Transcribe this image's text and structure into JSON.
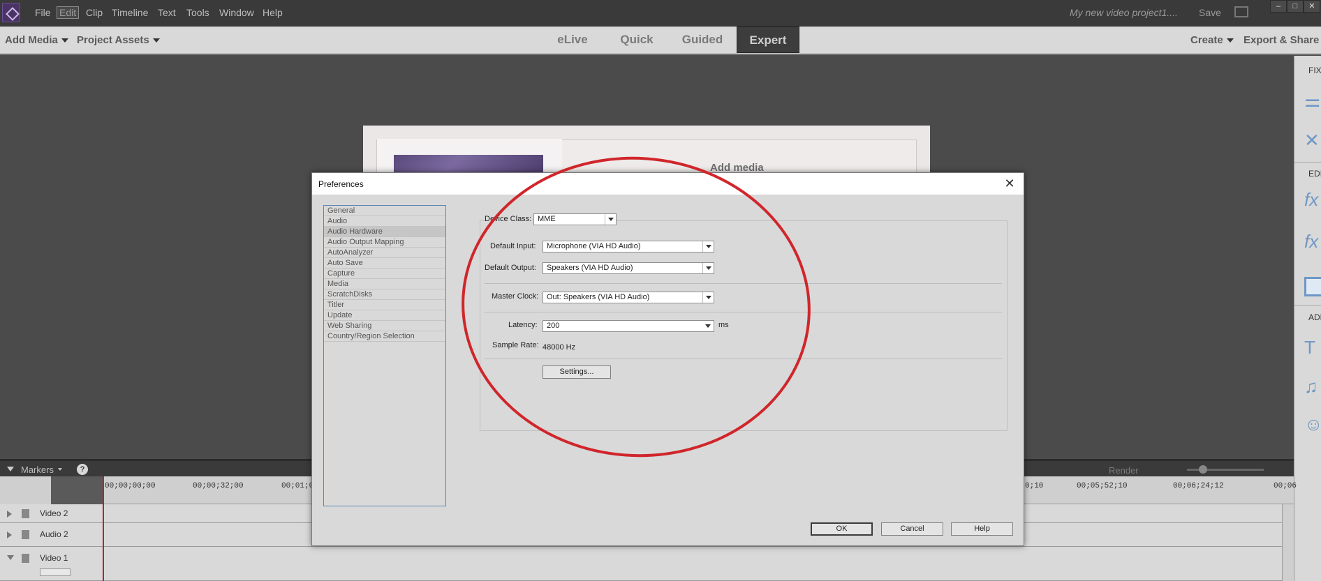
{
  "menubar": {
    "items": [
      "File",
      "Edit",
      "Clip",
      "Timeline",
      "Text",
      "Tools",
      "Window",
      "Help"
    ],
    "project_title": "My new video project1....",
    "save_label": "Save"
  },
  "toolbar": {
    "add_media": "Add Media",
    "project_assets": "Project Assets",
    "modes": [
      "eLive",
      "Quick",
      "Guided",
      "Expert"
    ],
    "active_mode": "Expert",
    "create": "Create",
    "export_share": "Export & Share"
  },
  "right_panel": {
    "fix_label": "FIX",
    "edit_label": "EDIT",
    "add_label": "ADD"
  },
  "monitor": {
    "add_media_label": "Add media"
  },
  "timeline": {
    "markers_label": "Markers",
    "help_label": "?",
    "render_label": "Render",
    "timecodes": [
      "00;00;00;00",
      "00;00;32;00",
      "00;01;0",
      "0;10",
      "00;05;52;10",
      "00;06;24;12",
      "00;06"
    ],
    "tracks": [
      "Video 2",
      "Audio 2",
      "Video 1"
    ]
  },
  "preferences": {
    "title": "Preferences",
    "categories": [
      "General",
      "Audio",
      "Audio Hardware",
      "Audio Output Mapping",
      "AutoAnalyzer",
      "Auto Save",
      "Capture",
      "Media",
      "ScratchDisks",
      "Titler",
      "Update",
      "Web Sharing",
      "Country/Region Selection"
    ],
    "selected_category": "Audio Hardware",
    "device_class_label": "Device Class:",
    "device_class_value": "MME",
    "default_input_label": "Default Input:",
    "default_input_value": "Microphone (VIA HD Audio)",
    "default_output_label": "Default Output:",
    "default_output_value": "Speakers (VIA HD Audio)",
    "master_clock_label": "Master Clock:",
    "master_clock_value": "Out: Speakers (VIA HD Audio)",
    "latency_label": "Latency:",
    "latency_value": "200",
    "latency_unit": "ms",
    "sample_rate_label": "Sample Rate:",
    "sample_rate_value": "48000 Hz",
    "settings_button": "Settings...",
    "ok_button": "OK",
    "cancel_button": "Cancel",
    "help_button": "Help"
  },
  "colors": {
    "annotation": "#d0262b",
    "selection_border": "#5b87b4"
  }
}
